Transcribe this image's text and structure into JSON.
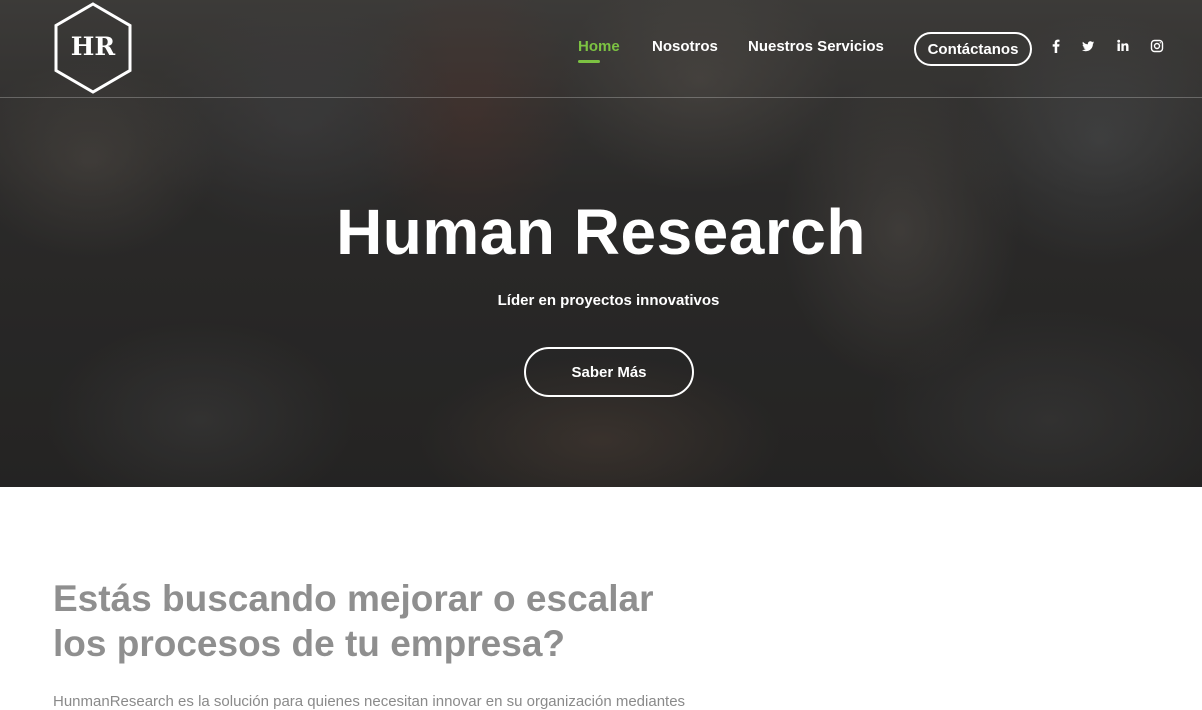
{
  "header": {
    "logo_text": "HR",
    "nav": [
      {
        "label": "Home",
        "active": true
      },
      {
        "label": "Nosotros",
        "active": false
      },
      {
        "label": "Nuestros Servicios",
        "active": false
      }
    ],
    "contact_label": "Contáctanos",
    "social_icons": [
      "facebook-icon",
      "twitter-icon",
      "linkedin-icon",
      "instagram-icon"
    ]
  },
  "hero": {
    "title": "Human Research",
    "subtitle": "Líder en proyectos innovativos",
    "button_label": "Saber Más"
  },
  "section": {
    "title_line1": "Estás buscando mejorar o escalar",
    "title_line2": "los procesos de tu empresa?",
    "text": "HunmanResearch es la solución para quienes necesitan innovar en su organización mediantes"
  },
  "colors": {
    "accent": "#7cc242",
    "heading_gray": "#8f8f8f",
    "body_gray": "#8a8a8a"
  }
}
